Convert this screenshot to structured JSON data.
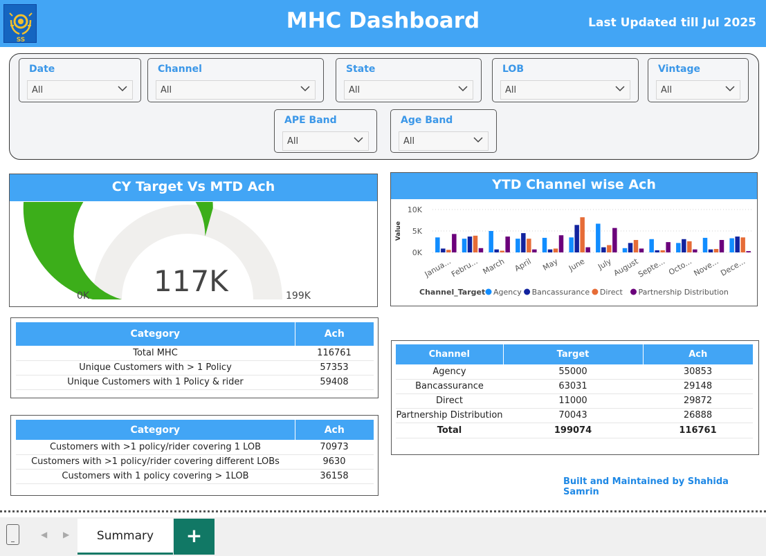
{
  "header": {
    "title": "MHC Dashboard",
    "last_updated": "Last Updated till Jul 2025"
  },
  "filters": [
    {
      "label": "Date",
      "value": "All"
    },
    {
      "label": "Channel",
      "value": "All"
    },
    {
      "label": "State",
      "value": "All"
    },
    {
      "label": "LOB",
      "value": "All"
    },
    {
      "label": "Vintage",
      "value": "All"
    },
    {
      "label": "APE Band",
      "value": "All"
    },
    {
      "label": "Age Band",
      "value": "All"
    }
  ],
  "gauge": {
    "title": "CY Target Vs MTD Ach",
    "value_label": "117K",
    "min_label": "0K",
    "max_label": "199K",
    "value": 116761,
    "min": 0,
    "max": 199074,
    "fill_color": "#3cae1a",
    "track_color": "#f0efed"
  },
  "chart_data": {
    "type": "bar",
    "title": "YTD Channel wise Ach",
    "ylabel": "Value",
    "ylim": [
      0,
      10000
    ],
    "yticks": [
      "0K",
      "5K",
      "10K"
    ],
    "legend_title": "Channel_Target",
    "legend_position": "bottom",
    "categories": [
      "Janua...",
      "Febru...",
      "March",
      "April",
      "May",
      "June",
      "July",
      "August",
      "Septe...",
      "Octo...",
      "Nove...",
      "Dece..."
    ],
    "series": [
      {
        "name": "Agency",
        "color": "#118dff",
        "values": [
          3500,
          3200,
          5000,
          3200,
          3400,
          3500,
          6700,
          1000,
          3100,
          2200,
          3400,
          3300
        ]
      },
      {
        "name": "Bancassurance",
        "color": "#12239e",
        "values": [
          900,
          3700,
          700,
          4500,
          700,
          6400,
          1200,
          2200,
          500,
          3100,
          700,
          3700
        ]
      },
      {
        "name": "Direct",
        "color": "#e66c37",
        "values": [
          600,
          3900,
          400,
          3200,
          900,
          8200,
          1700,
          2900,
          500,
          2600,
          800,
          3500
        ]
      },
      {
        "name": "Partnership Distribution",
        "color": "#6b007b",
        "values": [
          4300,
          1000,
          3700,
          700,
          4000,
          1200,
          5700,
          900,
          2400,
          700,
          2900,
          300
        ]
      }
    ]
  },
  "table1": {
    "headers": [
      "Category",
      "Ach"
    ],
    "rows": [
      [
        "Total MHC",
        "116761"
      ],
      [
        "Unique Customers with > 1 Policy",
        "57353"
      ],
      [
        "Unique Customers with 1 Policy & rider",
        "59408"
      ]
    ]
  },
  "table2": {
    "headers": [
      "Category",
      "Ach"
    ],
    "rows": [
      [
        "Customers with >1 policy/rider covering 1 LOB",
        "70973"
      ],
      [
        "Customers with >1 policy/rider covering different LOBs",
        "9630"
      ],
      [
        "Customers with 1 policy covering > 1LOB",
        "36158"
      ]
    ]
  },
  "table3": {
    "headers": [
      "Channel",
      "Target",
      "Ach"
    ],
    "rows": [
      [
        "Agency",
        "55000",
        "30853"
      ],
      [
        "Bancassurance",
        "63031",
        "29148"
      ],
      [
        "Direct",
        "11000",
        "29872"
      ],
      [
        "Partnership Distribution",
        "70043",
        "26888"
      ]
    ],
    "total": [
      "Total",
      "199074",
      "116761"
    ]
  },
  "credit": "Built and Maintained by Shahida Samrin",
  "footer": {
    "tab_label": "Summary",
    "add_label": "+"
  },
  "logo": {
    "text": "SS"
  }
}
